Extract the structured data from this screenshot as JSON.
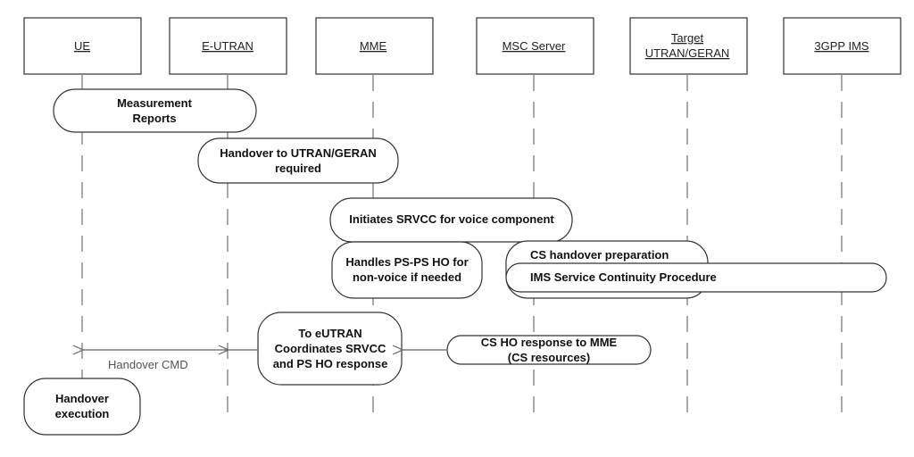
{
  "participants": [
    "UE",
    "E-UTRAN",
    "MME",
    "MSC Server",
    "Target",
    "UTRAN/GERAN",
    "3GPP IMS"
  ],
  "activities": {
    "measurement": [
      "Measurement",
      "Reports"
    ],
    "handover_required": [
      "Handover to UTRAN/GERAN",
      "required"
    ],
    "initiates_srvcc": "Initiates SRVCC for voice component",
    "handles_ps": [
      "Handles PS-PS HO for",
      "non-voice if needed"
    ],
    "cs_prep": "CS handover preparation",
    "ims_continuity": "IMS Service Continuity Procedure",
    "to_eutran": [
      "To eUTRAN",
      "Coordinates SRVCC",
      "and PS HO response"
    ],
    "cs_ho_response": [
      "CS HO response to MME",
      "(CS resources)"
    ],
    "handover_execution": [
      "Handover",
      "execution"
    ]
  },
  "messages": {
    "handover_cmd": "Handover CMD"
  }
}
